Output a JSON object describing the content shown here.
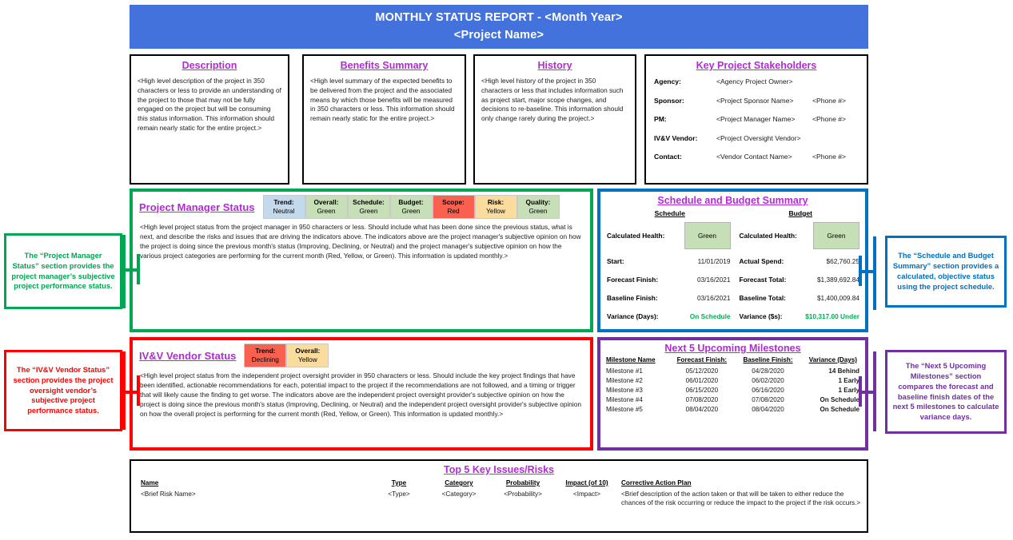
{
  "header": {
    "line1": "MONTHLY STATUS REPORT - <Month Year>",
    "line2": "<Project Name>",
    "bg_color": "#4472dd"
  },
  "colors": {
    "title_purple": "#b429d8",
    "green": "#00a651",
    "red": "#ff0000",
    "blue": "#0070c0",
    "purple": "#7030a0",
    "badge_blue": "#c5d9ec",
    "badge_green": "#c6dfb6",
    "badge_red": "#f9604f",
    "badge_yellow": "#fbdc9f",
    "status_green_text": "#00b050",
    "status_red_text": "#c00000"
  },
  "description": {
    "title": "Description",
    "body": "<High level description of the project in 350 characters or less to provide an understanding of the project to those that may not be fully engaged on the project but will be consuming this status information. This information should remain nearly static for the entire project.>"
  },
  "benefits": {
    "title": "Benefits Summary",
    "body": "<High level summary of the expected benefits to be delivered from the project and the associated means by which those benefits will be measured in 350 characters or less. This information should remain nearly static for the entire project.>"
  },
  "history": {
    "title": "History",
    "body": "<High level history of the project in 350 characters or less that includes information such as project start, major scope changes, and decisions to re-baseline. This information should only change rarely during the project.>"
  },
  "stakeholders": {
    "title": "Key Project Stakeholders",
    "rows": [
      {
        "label": "Agency:",
        "value": "<Agency Project Owner>",
        "phone": ""
      },
      {
        "label": "Sponsor:",
        "value": "<Project Sponsor Name>",
        "phone": "<Phone #>"
      },
      {
        "label": "PM:",
        "value": "<Project Manager Name>",
        "phone": "<Phone #>"
      },
      {
        "label": "IV&V Vendor:",
        "value": "<Project Oversight Vendor>",
        "phone": ""
      },
      {
        "label": "Contact:",
        "value": "<Vendor Contact Name>",
        "phone": "<Phone #>"
      }
    ]
  },
  "pm_status": {
    "title": "Project Manager Status",
    "badges": [
      {
        "key": "Trend:",
        "value": "Neutral",
        "color": "blue"
      },
      {
        "key": "Overall:",
        "value": "Green",
        "color": "green"
      },
      {
        "key": "Schedule:",
        "value": "Green",
        "color": "green"
      },
      {
        "key": "Budget:",
        "value": "Green",
        "color": "green"
      },
      {
        "key": "Scope:",
        "value": "Red",
        "color": "red"
      },
      {
        "key": "Risk:",
        "value": "Yellow",
        "color": "yellow"
      },
      {
        "key": "Quality:",
        "value": "Green",
        "color": "green"
      }
    ],
    "body": "<High level project status from the project manager in 950 characters or less. Should include what has been done since the previous status, what is next, and describe the risks and issues that are driving the indicators above. The indicators above are the project manager's subjective opinion on how the project is doing since the previous month's status (Improving, Declining, or Neutral) and the project manager's subjective opinion on how the various project categories are performing for the current month (Red, Yellow, or Green). This information is updated monthly.>"
  },
  "ivv_status": {
    "title": "IV&V Vendor Status",
    "badges": [
      {
        "key": "Trend:",
        "value": "Declining",
        "color": "red"
      },
      {
        "key": "Overall:",
        "value": "Yellow",
        "color": "yellow"
      }
    ],
    "body": "<High level project status from the independent project oversight provider in 950 characters or less. Should include the key project findings that have been identified, actionable recommendations for each, potential impact to the project if the recommendations are not followed, and a timing or trigger that will likely cause the finding to get worse. The indicators above are the independent project oversight provider's subjective opinion on how the project is doing since the previous month's status (Improving, Declining, or Neutral) and the independent project oversight provider's subjective opinion on how the overall project is performing for the current month (Red, Yellow, or Green). This information is updated monthly.>"
  },
  "schedule_budget": {
    "title": "Schedule and Budget Summary",
    "schedule": {
      "heading": "Schedule",
      "health_label": "Calculated Health:",
      "health_value": "Green",
      "rows": [
        {
          "key": "Start:",
          "value": "11/01/2019",
          "green": false
        },
        {
          "key": "Forecast Finish:",
          "value": "03/16/2021",
          "green": false
        },
        {
          "key": "Baseline Finish:",
          "value": "03/16/2021",
          "green": false
        },
        {
          "key": "Variance (Days):",
          "value": "On Schedule",
          "green": true
        }
      ]
    },
    "budget": {
      "heading": "Budget",
      "health_label": "Calculated Health:",
      "health_value": "Green",
      "rows": [
        {
          "key": "Actual Spend:",
          "value": "$62,760.25",
          "green": false
        },
        {
          "key": "Forecast Total:",
          "value": "$1,389,692.84",
          "green": false
        },
        {
          "key": "Baseline Total:",
          "value": "$1,400,009.84",
          "green": false
        },
        {
          "key": "Variance ($s):",
          "value": "$10,317.00 Under",
          "green": true
        }
      ]
    }
  },
  "milestones": {
    "title": "Next 5 Upcoming Milestones",
    "columns": [
      "Milestone Name",
      "Forecast Finish:",
      "Baseline Finish:",
      "Variance (Days)"
    ],
    "rows": [
      {
        "name": "Milestone #1",
        "forecast": "05/12/2020",
        "baseline": "04/28/2020",
        "variance": "14 Behind",
        "variance_class": "v-behind"
      },
      {
        "name": "Milestone #2",
        "forecast": "06/01/2020",
        "baseline": "06/02/2020",
        "variance": "1 Early",
        "variance_class": "v-early"
      },
      {
        "name": "Milestone #3",
        "forecast": "06/15/2020",
        "baseline": "06/16/2020",
        "variance": "1 Early",
        "variance_class": "v-early"
      },
      {
        "name": "Milestone #4",
        "forecast": "07/08/2020",
        "baseline": "07/08/2020",
        "variance": "On Schedule",
        "variance_class": "v-onsch"
      },
      {
        "name": "Milestone #5",
        "forecast": "08/04/2020",
        "baseline": "08/04/2020",
        "variance": "On Schedule",
        "variance_class": "v-onsch"
      }
    ]
  },
  "risks": {
    "title": "Top 5 Key Issues/Risks",
    "columns": [
      "Name",
      "Type",
      "Category",
      "Probability",
      "Impact (of 10)",
      "Corrective Action Plan"
    ],
    "rows": [
      {
        "name": "<Brief Risk Name>",
        "type": "<Type>",
        "category": "<Category>",
        "probability": "<Probability>",
        "impact": "<Impact>",
        "plan": "<Brief description of the action taken or that will be taken to either reduce the chances of the risk occurring or reduce the impact to the project if the risk occurs.>"
      }
    ]
  },
  "callouts": {
    "pm": "The “Project Manager Status” section provides the project manager’s subjective project performance status.",
    "ivv": "The “IV&V Vendor Status” section provides the project oversight vendor’s subjective project performance status.",
    "schedule_budget": "The “Schedule and Budget Summary” section provides a calculated, objective status using the project schedule.",
    "milestones": "The “Next 5 Upcoming Milestones” section compares the forecast and baseline finish dates of the next 5 milestones to calculate variance days."
  }
}
